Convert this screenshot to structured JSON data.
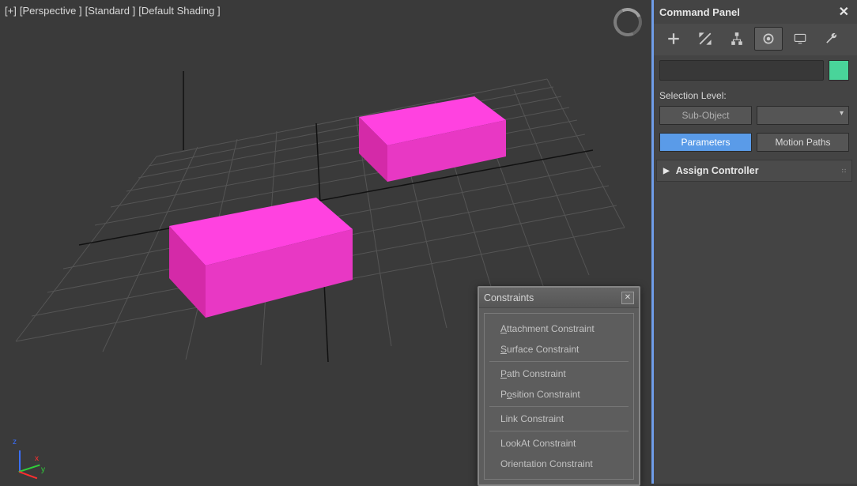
{
  "viewport": {
    "labels": [
      "[+]",
      "[Perspective ]",
      "[Standard ]",
      "[Default Shading ]"
    ]
  },
  "commandPanel": {
    "title": "Command Panel",
    "tabs": [
      "create",
      "modify",
      "hierarchy",
      "motion",
      "display",
      "utilities"
    ],
    "activeTab": "motion",
    "selectionLevelLabel": "Selection Level:",
    "subObjectLabel": "Sub-Object",
    "parametersLabel": "Parameters",
    "motionPathsLabel": "Motion Paths",
    "rollouts": {
      "assignController": "Assign Controller"
    },
    "colorSwatch": "#49d49a"
  },
  "constraintsPopup": {
    "title": "Constraints",
    "items": [
      {
        "label": "Attachment Constraint",
        "u": 0
      },
      {
        "label": "Surface Constraint",
        "u": 0
      },
      {
        "sep": true
      },
      {
        "label": "Path Constraint",
        "u": 0
      },
      {
        "label": "Position Constraint",
        "u": 1
      },
      {
        "sep": true
      },
      {
        "label": "Link Constraint",
        "u": -1
      },
      {
        "sep": true
      },
      {
        "label": "LookAt Constraint",
        "u": -1
      },
      {
        "label": "Orientation Constraint",
        "u": -1
      }
    ]
  }
}
